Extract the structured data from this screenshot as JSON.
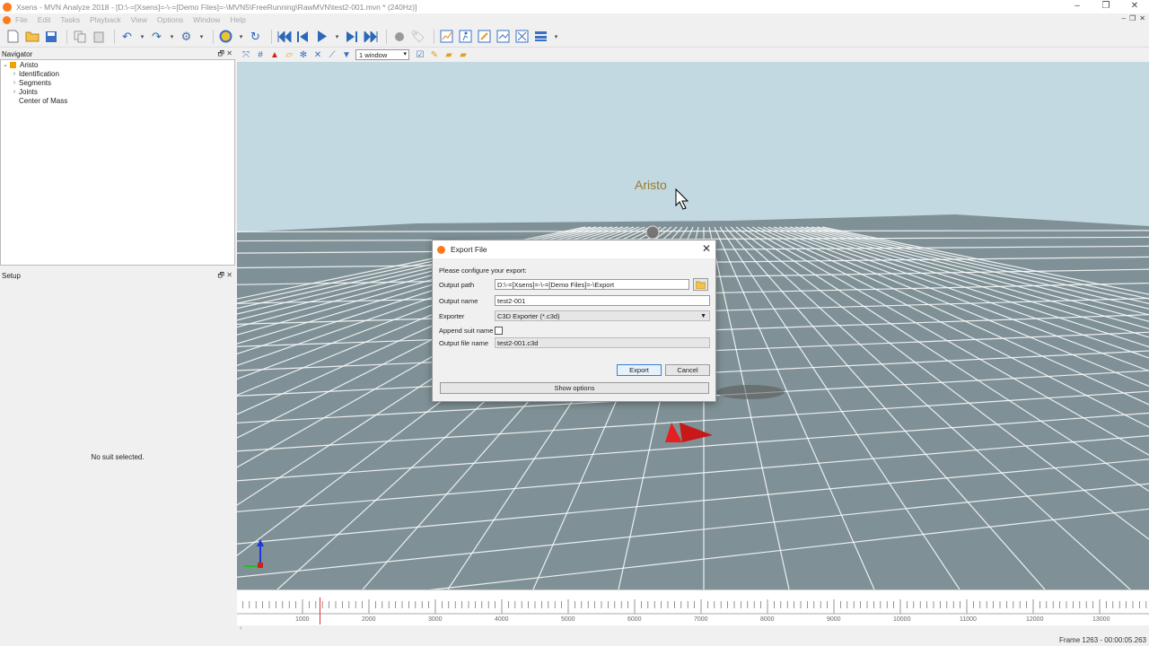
{
  "window": {
    "title": "Xsens - MVN Analyze 2018 - [D:\\-=[Xsens]=-\\-=[Demo Files]=-\\MVN5\\FreeRunning\\RawMVN\\test2-001.mvn * (240Hz)]",
    "controls": [
      "–",
      "❐",
      "✕"
    ]
  },
  "menu": [
    "File",
    "Edit",
    "Tasks",
    "Playback",
    "View",
    "Options",
    "Window",
    "Help"
  ],
  "navigator": {
    "title": "Navigator",
    "tree": [
      {
        "label": "Aristo",
        "expanded": true
      },
      {
        "label": "Identification"
      },
      {
        "label": "Segments"
      },
      {
        "label": "Joints"
      },
      {
        "label": "Center of Mass"
      }
    ]
  },
  "setup": {
    "title": "Setup",
    "empty_text": "No suit selected."
  },
  "viewport": {
    "window_select": "1 window",
    "character_label": "Aristo"
  },
  "timeline": {
    "labels": [
      "1000",
      "2000",
      "3000",
      "4000",
      "5000",
      "6000",
      "7000",
      "8000",
      "9000",
      "10000",
      "11000",
      "12000",
      "13000"
    ],
    "current_frame": 1263
  },
  "status": {
    "text": "Frame 1263 - 00:00:05.263"
  },
  "dialog": {
    "title": "Export File",
    "intro": "Please configure your export:",
    "fields": {
      "output_path_label": "Output path",
      "output_path_value": "D:\\-=[Xsens]=-\\-=[Demo Files]=-\\Export",
      "output_name_label": "Output name",
      "output_name_value": "test2-001",
      "exporter_label": "Exporter",
      "exporter_value": "C3D Exporter (*.c3d)",
      "append_label": "Append suit name",
      "append_checked": false,
      "file_name_label": "Output file name",
      "file_name_value": "test2-001.c3d"
    },
    "buttons": {
      "export": "Export",
      "cancel": "Cancel",
      "show_options": "Show options"
    }
  },
  "colors": {
    "sky": "#c2d9e1",
    "floor": "#7f9196",
    "grid": "#ffffff",
    "accent": "#ff7a1a",
    "label": "#9a7a2e",
    "marker": "#e62020",
    "playhead": "#e03030"
  }
}
